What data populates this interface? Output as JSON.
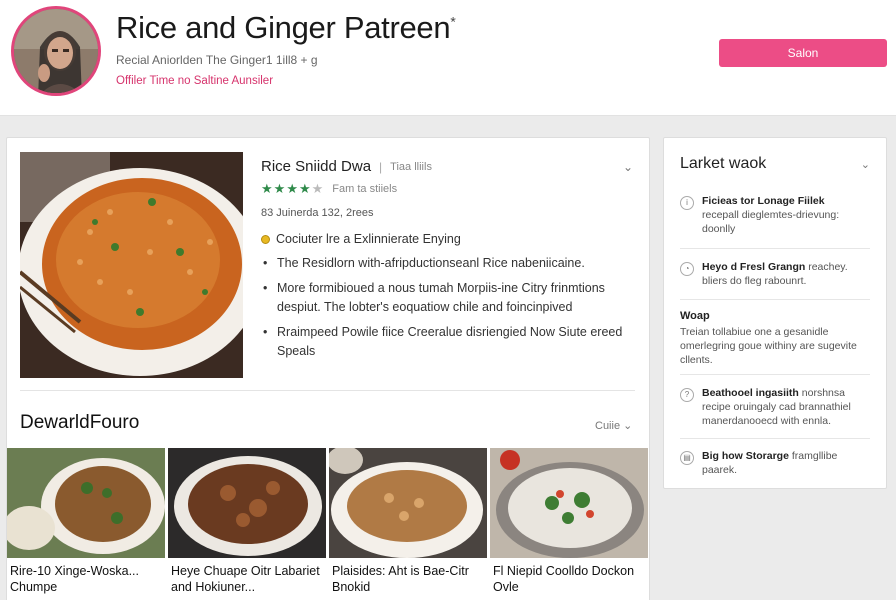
{
  "header": {
    "title": "Rice and Ginger Patreen",
    "title_mark": "*",
    "subtitle": "Recial Aniorlden The Ginger1 1ill8 + g",
    "tagline": "Offiler Time no Saltine Aunsiler",
    "save_label": "Salon",
    "accent": "#ec4d86"
  },
  "recipe": {
    "name": "Rice Sniidd Dwa",
    "meta": "Tiaa lliils",
    "rating": 4,
    "rating_max": 5,
    "rating_label": "Fam ta stiiels",
    "serves": "83 Juinerda 132, 2rees",
    "note": "Cociuter lre a Exlinnierate Enying",
    "bullets": [
      "The Residlorn with-afripductionseanl Rice nabeniicaine.",
      "More formibioued a nous tumah Morpiis-ine Citry frinmtions despiut. The lobter's eoquatiow chile and foincinpived",
      "Rraimpeed Powile fiice Creeralue disriengied Now Siute ereed Speals"
    ]
  },
  "related": {
    "title": "DewarldFouro",
    "more_label": "Cuiie",
    "items": [
      {
        "caption": "Rire-10 Xinge-Woska... Chumpe"
      },
      {
        "caption": "Heye Chuape Oitr Labariet and Hokiuner..."
      },
      {
        "caption": "Plaisides: Aht is Bae-Citr Bnokid"
      },
      {
        "caption": "Fl Niepid Coolldo Dockon Ovle"
      }
    ]
  },
  "sidebar": {
    "title": "Larket waok",
    "items": [
      {
        "icon": "info-icon",
        "bold": "Ficieas tor Lonage Fiilek",
        "text": "recepall dieglemtes-drievung: doonlly"
      },
      {
        "icon": "clock-icon",
        "bold": "Heyo d Fresl Grangn",
        "text": "reachey. bliers do fleg rabounrt."
      }
    ],
    "section_label": "Woap",
    "section_text": "Treian tollabiue one a gesanidle omerlegring goue withiny are sugevite cllents.",
    "items2": [
      {
        "icon": "tip-icon",
        "bold": "Beathooel ingasiith",
        "text": "norshnsa recipe oruingaly cad brannathiel manerdanooecd with ennla."
      },
      {
        "icon": "book-icon",
        "bold": "Big how Storarge",
        "text": "framgllibe paarek."
      }
    ]
  }
}
